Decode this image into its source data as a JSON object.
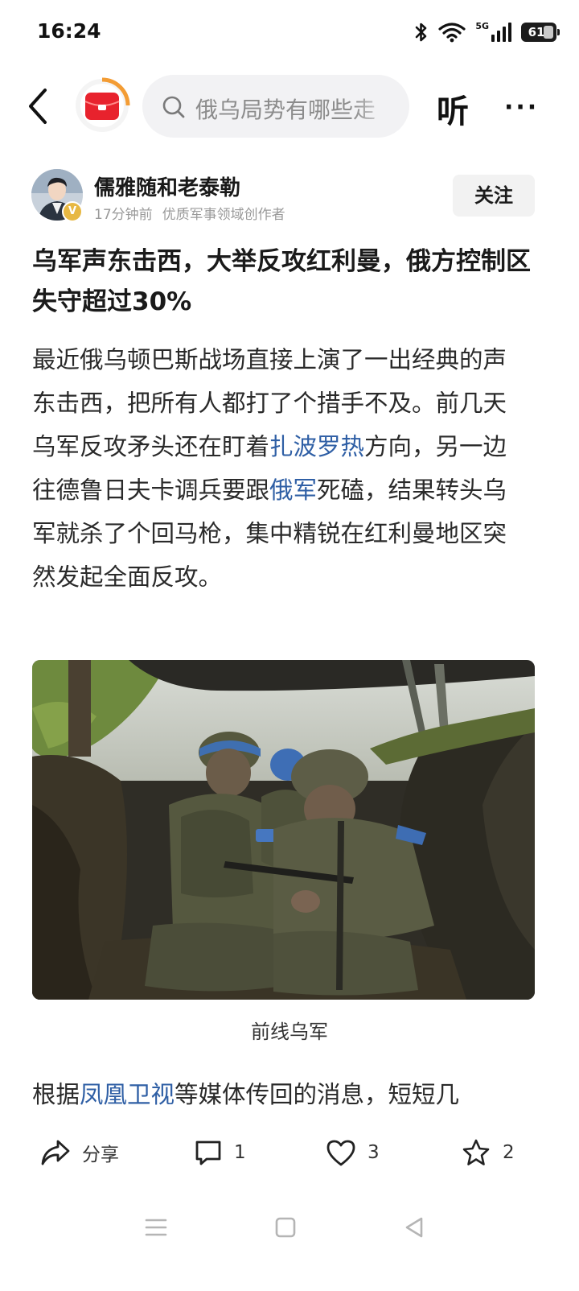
{
  "status_bar": {
    "time": "16:24",
    "network": "5G",
    "battery": "61",
    "icons": [
      "bluetooth-icon",
      "wifi-icon",
      "signal-icon",
      "battery-icon"
    ]
  },
  "top_bar": {
    "search_placeholder": "俄乌局势有哪些走",
    "listen_label": "听",
    "more_label": "···"
  },
  "author": {
    "name": "儒雅随和老泰勒",
    "time_ago": "17分钟前",
    "description": "优质军事领域创作者",
    "verified_mark": "V",
    "follow_label": "关注"
  },
  "article": {
    "title": "乌军声东击西，大举反攻红利曼，俄方控制区失守超过30%",
    "para1_a": "最近俄乌顿巴斯战场直接上演了一出经典的声东击西，把所有人都打了个措手不及。前几天乌军反攻矛头还在盯着",
    "para1_link1": "扎波罗热",
    "para1_b": "方向，另一边往德鲁日夫卡调兵要跟",
    "para1_link2": "俄军",
    "para1_c": "死磕，结果转头乌军就杀了个回马枪，集中精锐在红利曼地区突然发起全面反攻。",
    "photo_caption": "前线乌军",
    "para2_a": "根据",
    "para2_link": "凤凰卫视",
    "para2_b": "等媒体传回的消息，短短几"
  },
  "actions": {
    "share_label": "分享",
    "comment_count": "1",
    "like_count": "3",
    "favorite_count": "2"
  },
  "colors": {
    "link": "#2f5fa5",
    "logo_red": "#e8222d",
    "logo_ring": "#f39c34"
  }
}
